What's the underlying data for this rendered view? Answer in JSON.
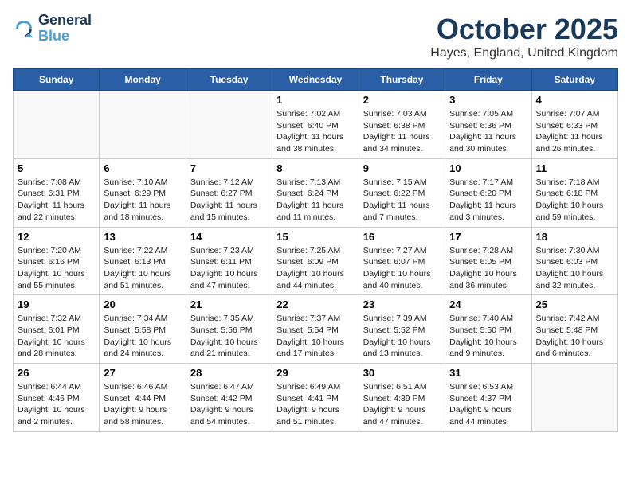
{
  "logo": {
    "line1": "General",
    "line2": "Blue"
  },
  "title": "October 2025",
  "location": "Hayes, England, United Kingdom",
  "days_of_week": [
    "Sunday",
    "Monday",
    "Tuesday",
    "Wednesday",
    "Thursday",
    "Friday",
    "Saturday"
  ],
  "weeks": [
    [
      {
        "day": "",
        "info": ""
      },
      {
        "day": "",
        "info": ""
      },
      {
        "day": "",
        "info": ""
      },
      {
        "day": "1",
        "info": "Sunrise: 7:02 AM\nSunset: 6:40 PM\nDaylight: 11 hours and 38 minutes."
      },
      {
        "day": "2",
        "info": "Sunrise: 7:03 AM\nSunset: 6:38 PM\nDaylight: 11 hours and 34 minutes."
      },
      {
        "day": "3",
        "info": "Sunrise: 7:05 AM\nSunset: 6:36 PM\nDaylight: 11 hours and 30 minutes."
      },
      {
        "day": "4",
        "info": "Sunrise: 7:07 AM\nSunset: 6:33 PM\nDaylight: 11 hours and 26 minutes."
      }
    ],
    [
      {
        "day": "5",
        "info": "Sunrise: 7:08 AM\nSunset: 6:31 PM\nDaylight: 11 hours and 22 minutes."
      },
      {
        "day": "6",
        "info": "Sunrise: 7:10 AM\nSunset: 6:29 PM\nDaylight: 11 hours and 18 minutes."
      },
      {
        "day": "7",
        "info": "Sunrise: 7:12 AM\nSunset: 6:27 PM\nDaylight: 11 hours and 15 minutes."
      },
      {
        "day": "8",
        "info": "Sunrise: 7:13 AM\nSunset: 6:24 PM\nDaylight: 11 hours and 11 minutes."
      },
      {
        "day": "9",
        "info": "Sunrise: 7:15 AM\nSunset: 6:22 PM\nDaylight: 11 hours and 7 minutes."
      },
      {
        "day": "10",
        "info": "Sunrise: 7:17 AM\nSunset: 6:20 PM\nDaylight: 11 hours and 3 minutes."
      },
      {
        "day": "11",
        "info": "Sunrise: 7:18 AM\nSunset: 6:18 PM\nDaylight: 10 hours and 59 minutes."
      }
    ],
    [
      {
        "day": "12",
        "info": "Sunrise: 7:20 AM\nSunset: 6:16 PM\nDaylight: 10 hours and 55 minutes."
      },
      {
        "day": "13",
        "info": "Sunrise: 7:22 AM\nSunset: 6:13 PM\nDaylight: 10 hours and 51 minutes."
      },
      {
        "day": "14",
        "info": "Sunrise: 7:23 AM\nSunset: 6:11 PM\nDaylight: 10 hours and 47 minutes."
      },
      {
        "day": "15",
        "info": "Sunrise: 7:25 AM\nSunset: 6:09 PM\nDaylight: 10 hours and 44 minutes."
      },
      {
        "day": "16",
        "info": "Sunrise: 7:27 AM\nSunset: 6:07 PM\nDaylight: 10 hours and 40 minutes."
      },
      {
        "day": "17",
        "info": "Sunrise: 7:28 AM\nSunset: 6:05 PM\nDaylight: 10 hours and 36 minutes."
      },
      {
        "day": "18",
        "info": "Sunrise: 7:30 AM\nSunset: 6:03 PM\nDaylight: 10 hours and 32 minutes."
      }
    ],
    [
      {
        "day": "19",
        "info": "Sunrise: 7:32 AM\nSunset: 6:01 PM\nDaylight: 10 hours and 28 minutes."
      },
      {
        "day": "20",
        "info": "Sunrise: 7:34 AM\nSunset: 5:58 PM\nDaylight: 10 hours and 24 minutes."
      },
      {
        "day": "21",
        "info": "Sunrise: 7:35 AM\nSunset: 5:56 PM\nDaylight: 10 hours and 21 minutes."
      },
      {
        "day": "22",
        "info": "Sunrise: 7:37 AM\nSunset: 5:54 PM\nDaylight: 10 hours and 17 minutes."
      },
      {
        "day": "23",
        "info": "Sunrise: 7:39 AM\nSunset: 5:52 PM\nDaylight: 10 hours and 13 minutes."
      },
      {
        "day": "24",
        "info": "Sunrise: 7:40 AM\nSunset: 5:50 PM\nDaylight: 10 hours and 9 minutes."
      },
      {
        "day": "25",
        "info": "Sunrise: 7:42 AM\nSunset: 5:48 PM\nDaylight: 10 hours and 6 minutes."
      }
    ],
    [
      {
        "day": "26",
        "info": "Sunrise: 6:44 AM\nSunset: 4:46 PM\nDaylight: 10 hours and 2 minutes."
      },
      {
        "day": "27",
        "info": "Sunrise: 6:46 AM\nSunset: 4:44 PM\nDaylight: 9 hours and 58 minutes."
      },
      {
        "day": "28",
        "info": "Sunrise: 6:47 AM\nSunset: 4:42 PM\nDaylight: 9 hours and 54 minutes."
      },
      {
        "day": "29",
        "info": "Sunrise: 6:49 AM\nSunset: 4:41 PM\nDaylight: 9 hours and 51 minutes."
      },
      {
        "day": "30",
        "info": "Sunrise: 6:51 AM\nSunset: 4:39 PM\nDaylight: 9 hours and 47 minutes."
      },
      {
        "day": "31",
        "info": "Sunrise: 6:53 AM\nSunset: 4:37 PM\nDaylight: 9 hours and 44 minutes."
      },
      {
        "day": "",
        "info": ""
      }
    ]
  ]
}
